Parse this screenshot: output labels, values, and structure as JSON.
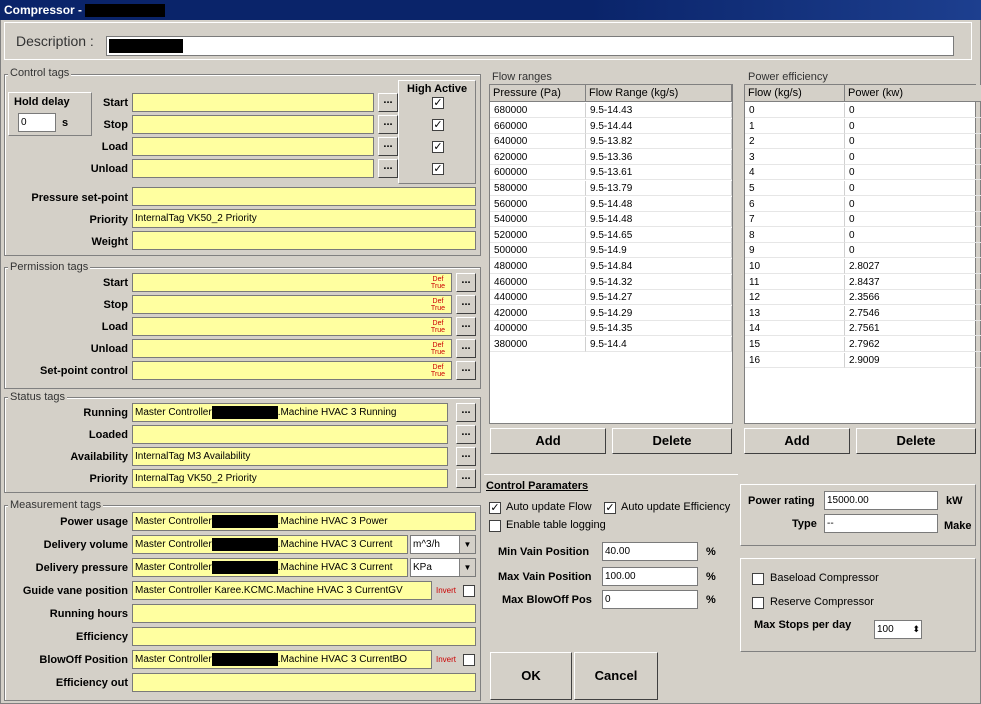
{
  "title": "Compressor -",
  "description": {
    "label": "Description :",
    "value": ""
  },
  "control_tags": {
    "group_label": "Control tags",
    "hold_delay_label": "Hold delay",
    "hold_delay_value": "0",
    "hold_delay_unit": "s",
    "high_active_label": "High Active",
    "rows": [
      {
        "label": "Start",
        "value": "",
        "checked": "☑"
      },
      {
        "label": "Stop",
        "value": "",
        "checked": "☑"
      },
      {
        "label": "Load",
        "value": "",
        "checked": "☑"
      },
      {
        "label": "Unload",
        "value": "",
        "checked": "☑"
      }
    ],
    "pressure_setpoint_label": "Pressure set-point",
    "pressure_setpoint_value": "",
    "priority_label": "Priority",
    "priority_value": "InternalTag VK50_2 Priority",
    "weight_label": "Weight",
    "weight_value": ""
  },
  "permission_tags": {
    "group_label": "Permission tags",
    "def_text": "Def True",
    "rows": [
      {
        "label": "Start",
        "value": ""
      },
      {
        "label": "Stop",
        "value": ""
      },
      {
        "label": "Load",
        "value": ""
      },
      {
        "label": "Unload",
        "value": ""
      },
      {
        "label": "Set-point control",
        "value": ""
      }
    ]
  },
  "status_tags": {
    "group_label": "Status tags",
    "rows": [
      {
        "label": "Running",
        "prefix": "Master Controller",
        "suffix": ".Machine HVAC 3 Running",
        "redacted": true
      },
      {
        "label": "Loaded",
        "prefix": "",
        "suffix": "",
        "redacted": false
      },
      {
        "label": "Availability",
        "prefix": "InternalTag M3 Availability",
        "suffix": "",
        "redacted": false
      },
      {
        "label": "Priority",
        "prefix": "InternalTag VK50_2 Priority",
        "suffix": "",
        "redacted": false
      }
    ]
  },
  "measurement_tags": {
    "group_label": "Measurement tags",
    "invert_label": "Invert",
    "rows": [
      {
        "label": "Power usage",
        "prefix": "Master Controller",
        "suffix": ".Machine HVAC 3 Power",
        "redacted": true,
        "unit": ""
      },
      {
        "label": "Delivery volume",
        "prefix": "Master Controller",
        "suffix": ".Machine HVAC 3 Current",
        "redacted": true,
        "unit": "m^3/h"
      },
      {
        "label": "Delivery pressure",
        "prefix": "Master Controller",
        "suffix": ".Machine HVAC 3 Current",
        "redacted": true,
        "unit": "KPa"
      },
      {
        "label": "Guide vane position",
        "prefix": "Master Controller Karee.KCMC.Machine HVAC 3 CurrentGV",
        "suffix": "",
        "redacted": false,
        "unit": ""
      },
      {
        "label": "Running hours",
        "prefix": "",
        "suffix": "",
        "redacted": false,
        "unit": ""
      },
      {
        "label": "Efficiency",
        "prefix": "",
        "suffix": "",
        "redacted": false,
        "unit": ""
      },
      {
        "label": "BlowOff Position",
        "prefix": "Master Controller",
        "suffix": ".Machine HVAC 3 CurrentBO",
        "redacted": true,
        "unit": ""
      },
      {
        "label": "Efficiency out",
        "prefix": "",
        "suffix": "",
        "redacted": false,
        "unit": ""
      }
    ]
  },
  "flow_ranges": {
    "group_label": "Flow ranges",
    "headers": [
      "Pressure (Pa)",
      "Flow Range (kg/s)"
    ],
    "rows": [
      [
        "680000",
        "9.5-14.43"
      ],
      [
        "660000",
        "9.5-14.44"
      ],
      [
        "640000",
        "9.5-13.82"
      ],
      [
        "620000",
        "9.5-13.36"
      ],
      [
        "600000",
        "9.5-13.61"
      ],
      [
        "580000",
        "9.5-13.79"
      ],
      [
        "560000",
        "9.5-14.48"
      ],
      [
        "540000",
        "9.5-14.48"
      ],
      [
        "520000",
        "9.5-14.65"
      ],
      [
        "500000",
        "9.5-14.9"
      ],
      [
        "480000",
        "9.5-14.84"
      ],
      [
        "460000",
        "9.5-14.32"
      ],
      [
        "440000",
        "9.5-14.27"
      ],
      [
        "420000",
        "9.5-14.29"
      ],
      [
        "400000",
        "9.5-14.35"
      ],
      [
        "380000",
        "9.5-14.4"
      ]
    ],
    "add_label": "Add",
    "delete_label": "Delete"
  },
  "power_efficiency": {
    "group_label": "Power efficiency",
    "headers": [
      "Flow (kg/s)",
      "Power (kw)"
    ],
    "rows": [
      [
        "0",
        "0"
      ],
      [
        "1",
        "0"
      ],
      [
        "2",
        "0"
      ],
      [
        "3",
        "0"
      ],
      [
        "4",
        "0"
      ],
      [
        "5",
        "0"
      ],
      [
        "6",
        "0"
      ],
      [
        "7",
        "0"
      ],
      [
        "8",
        "0"
      ],
      [
        "9",
        "0"
      ],
      [
        "10",
        "2.8027"
      ],
      [
        "11",
        "2.8437"
      ],
      [
        "12",
        "2.3566"
      ],
      [
        "13",
        "2.7546"
      ],
      [
        "14",
        "2.7561"
      ],
      [
        "15",
        "2.7962"
      ],
      [
        "16",
        "2.9009"
      ]
    ],
    "add_label": "Add",
    "delete_label": "Delete"
  },
  "control_parameters": {
    "title": "Control Paramaters",
    "auto_flow_label": "Auto update Flow",
    "auto_eff_label": "Auto update Efficiency",
    "table_logging_label": "Enable table logging",
    "min_vain_label": "Min Vain Position",
    "min_vain_value": "40.00",
    "max_vain_label": "Max Vain Position",
    "max_vain_value": "100.00",
    "max_blowoff_label": "Max BlowOff Pos",
    "max_blowoff_value": "0",
    "pct": "%"
  },
  "power": {
    "rating_label": "Power rating",
    "rating_value": "15000.00",
    "rating_unit": "kW",
    "type_label": "Type",
    "type_value": "--",
    "make_label": "Make"
  },
  "options": {
    "baseload_label": "Baseload Compressor",
    "reserve_label": "Reserve Compressor",
    "max_stops_label": "Max Stops per day",
    "max_stops_value": "100"
  },
  "ok_label": "OK",
  "cancel_label": "Cancel",
  "check": "✓"
}
